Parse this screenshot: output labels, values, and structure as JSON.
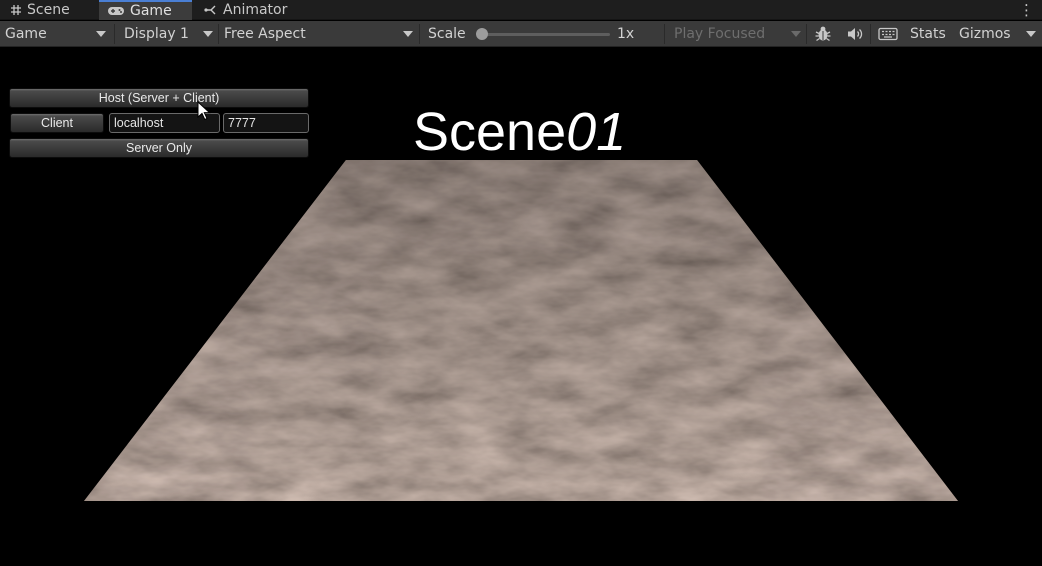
{
  "tabs": [
    {
      "label": "Scene",
      "icon": "grid-icon",
      "active": false
    },
    {
      "label": "Game",
      "icon": "gamepad-icon",
      "active": true
    },
    {
      "label": "Animator",
      "icon": "animator-icon",
      "active": false
    }
  ],
  "toolbar": {
    "view_mode": "Game",
    "display": "Display 1",
    "aspect": "Free Aspect",
    "scale_label": "Scale",
    "scale_value": "1x",
    "scale_level": 0.0,
    "play_mode": "Play Focused",
    "stats_label": "Stats",
    "gizmos_label": "Gizmos"
  },
  "game": {
    "scene_title_text": "Scene",
    "scene_title_num": "01",
    "host_button": "Host (Server + Client)",
    "client_button": "Client",
    "address_value": "localhost",
    "port_value": "7777",
    "server_button": "Server Only"
  },
  "colors": {
    "background": "#000000",
    "tab_active_accent": "#4a7fd4",
    "toolbar": "#3a3a3a",
    "ground": "#6b5a50"
  }
}
